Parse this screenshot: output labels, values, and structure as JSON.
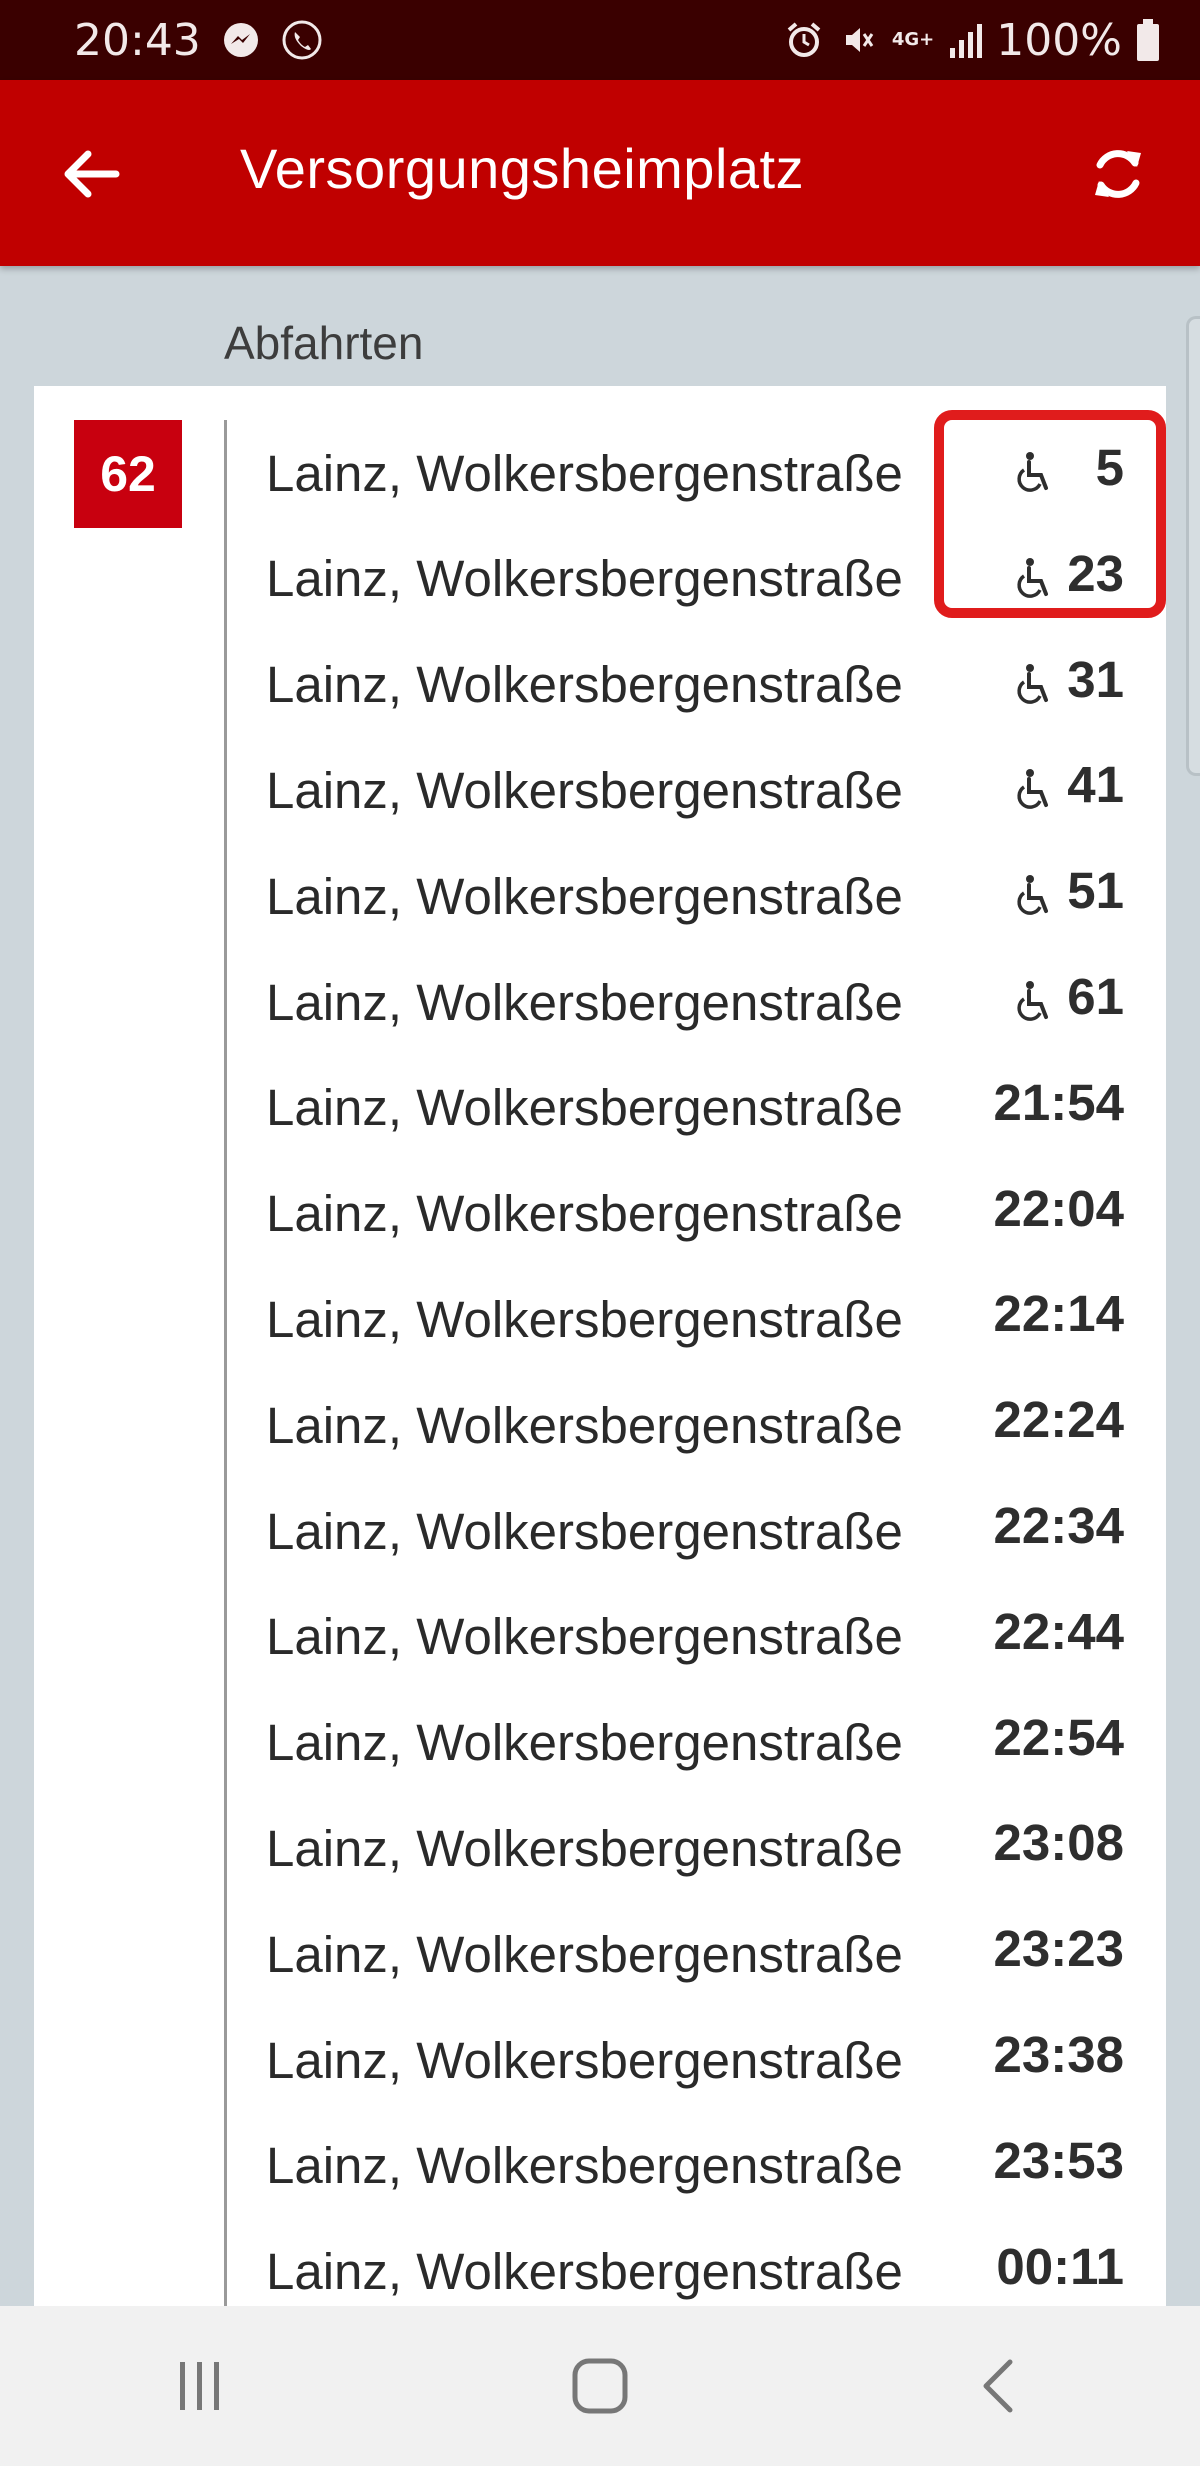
{
  "status_bar": {
    "time": "20:43",
    "left_icons": [
      "messenger-icon",
      "phone-call-icon"
    ],
    "right_icons": [
      "alarm-icon",
      "mute-icon",
      "network-4g-icon",
      "signal-icon"
    ],
    "network_label": "4G+",
    "battery_text": "100%"
  },
  "app_bar": {
    "title": "Versorgungsheimplatz",
    "back_icon": "arrow-left-icon",
    "refresh_icon": "refresh-icon"
  },
  "section": {
    "header": "Abfahrten"
  },
  "line": {
    "number": "62",
    "color": "#c8000f"
  },
  "departures": [
    {
      "destination": "Lainz, Wolkersbergenstraße",
      "time": "5",
      "accessible": true
    },
    {
      "destination": "Lainz, Wolkersbergenstraße",
      "time": "23",
      "accessible": true
    },
    {
      "destination": "Lainz, Wolkersbergenstraße",
      "time": "31",
      "accessible": true
    },
    {
      "destination": "Lainz, Wolkersbergenstraße",
      "time": "41",
      "accessible": true
    },
    {
      "destination": "Lainz, Wolkersbergenstraße",
      "time": "51",
      "accessible": true
    },
    {
      "destination": "Lainz, Wolkersbergenstraße",
      "time": "61",
      "accessible": true
    },
    {
      "destination": "Lainz, Wolkersbergenstraße",
      "time": "21:54",
      "accessible": false
    },
    {
      "destination": "Lainz, Wolkersbergenstraße",
      "time": "22:04",
      "accessible": false
    },
    {
      "destination": "Lainz, Wolkersbergenstraße",
      "time": "22:14",
      "accessible": false
    },
    {
      "destination": "Lainz, Wolkersbergenstraße",
      "time": "22:24",
      "accessible": false
    },
    {
      "destination": "Lainz, Wolkersbergenstraße",
      "time": "22:34",
      "accessible": false
    },
    {
      "destination": "Lainz, Wolkersbergenstraße",
      "time": "22:44",
      "accessible": false
    },
    {
      "destination": "Lainz, Wolkersbergenstraße",
      "time": "22:54",
      "accessible": false
    },
    {
      "destination": "Lainz, Wolkersbergenstraße",
      "time": "23:08",
      "accessible": false
    },
    {
      "destination": "Lainz, Wolkersbergenstraße",
      "time": "23:23",
      "accessible": false
    },
    {
      "destination": "Lainz, Wolkersbergenstraße",
      "time": "23:38",
      "accessible": false
    },
    {
      "destination": "Lainz, Wolkersbergenstraße",
      "time": "23:53",
      "accessible": false
    },
    {
      "destination": "Lainz, Wolkersbergenstraße",
      "time": "00:11",
      "accessible": false
    }
  ],
  "annotation": {
    "type": "red-box",
    "color": "#e01c1c"
  },
  "nav_bar": {
    "icons": [
      "recent-apps-icon",
      "home-icon",
      "back-icon"
    ]
  },
  "colors": {
    "status_bar": "#3a0000",
    "app_bar": "#c00000",
    "background": "#cdd6db"
  }
}
